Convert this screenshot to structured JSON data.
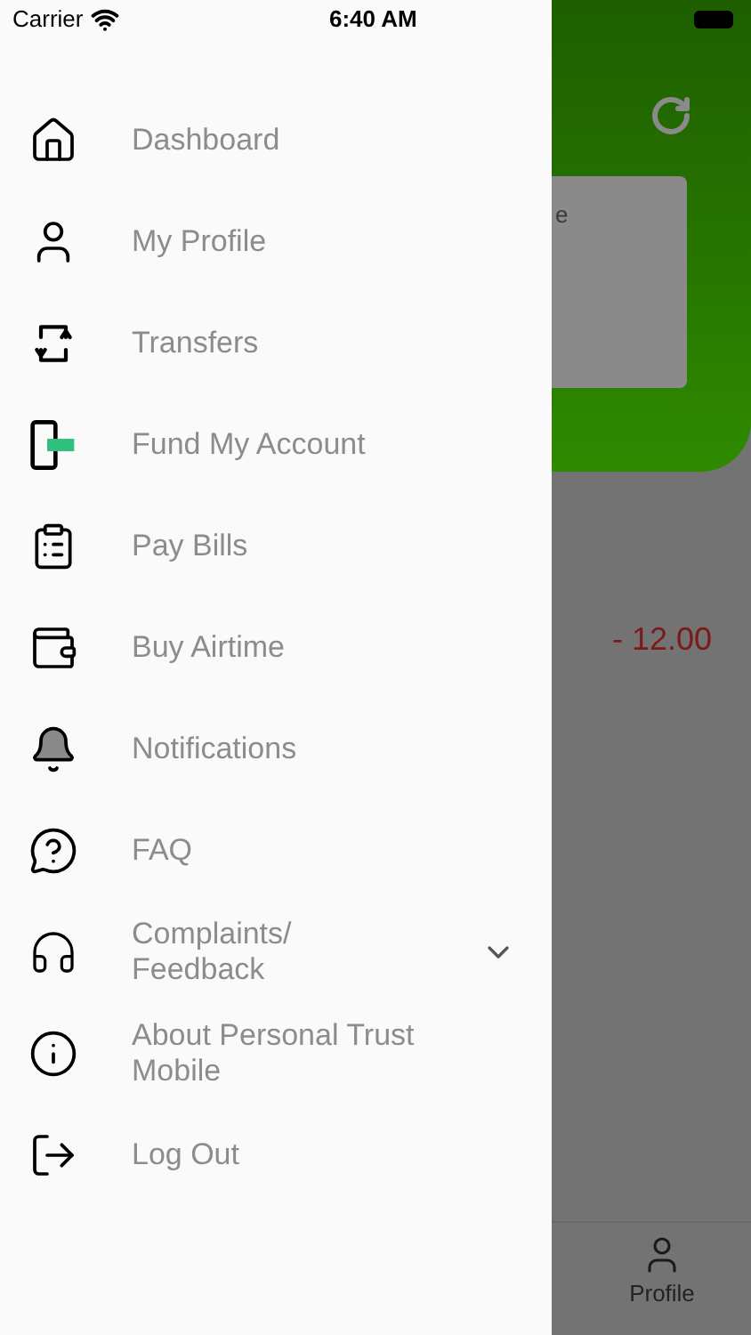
{
  "status_bar": {
    "carrier": "Carrier",
    "time": "6:40 AM"
  },
  "menu": [
    {
      "label": "Dashboard"
    },
    {
      "label": "My Profile"
    },
    {
      "label": "Transfers"
    },
    {
      "label": "Fund My Account"
    },
    {
      "label": "Pay Bills"
    },
    {
      "label": "Buy Airtime"
    },
    {
      "label": "Notifications"
    },
    {
      "label": "FAQ"
    },
    {
      "label": "Complaints/ Feedback",
      "expanded": false
    },
    {
      "label": "About Personal Trust Mobile"
    },
    {
      "label": "Log Out"
    }
  ],
  "background": {
    "card_text": "e",
    "amount": "- 12.00",
    "tab_bar": [
      {
        "label": "Profile"
      }
    ]
  }
}
